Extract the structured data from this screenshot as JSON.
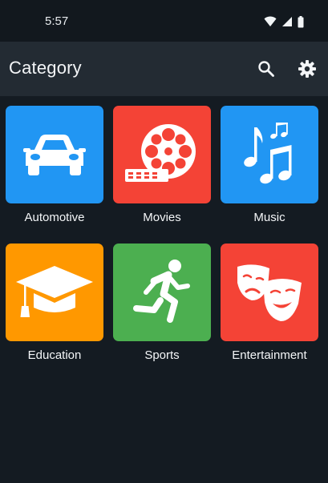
{
  "status_bar": {
    "time": "5:57"
  },
  "app_bar": {
    "title": "Category"
  },
  "categories": [
    {
      "label": "Automotive",
      "color": "#2196f3",
      "icon": "car-icon"
    },
    {
      "label": "Movies",
      "color": "#f44336",
      "icon": "film-reel-icon"
    },
    {
      "label": "Music",
      "color": "#2196f3",
      "icon": "music-notes-icon"
    },
    {
      "label": "Education",
      "color": "#ff9800",
      "icon": "graduation-cap-icon"
    },
    {
      "label": "Sports",
      "color": "#4caf50",
      "icon": "running-person-icon"
    },
    {
      "label": "Entertainment",
      "color": "#f44336",
      "icon": "theater-masks-icon"
    }
  ]
}
